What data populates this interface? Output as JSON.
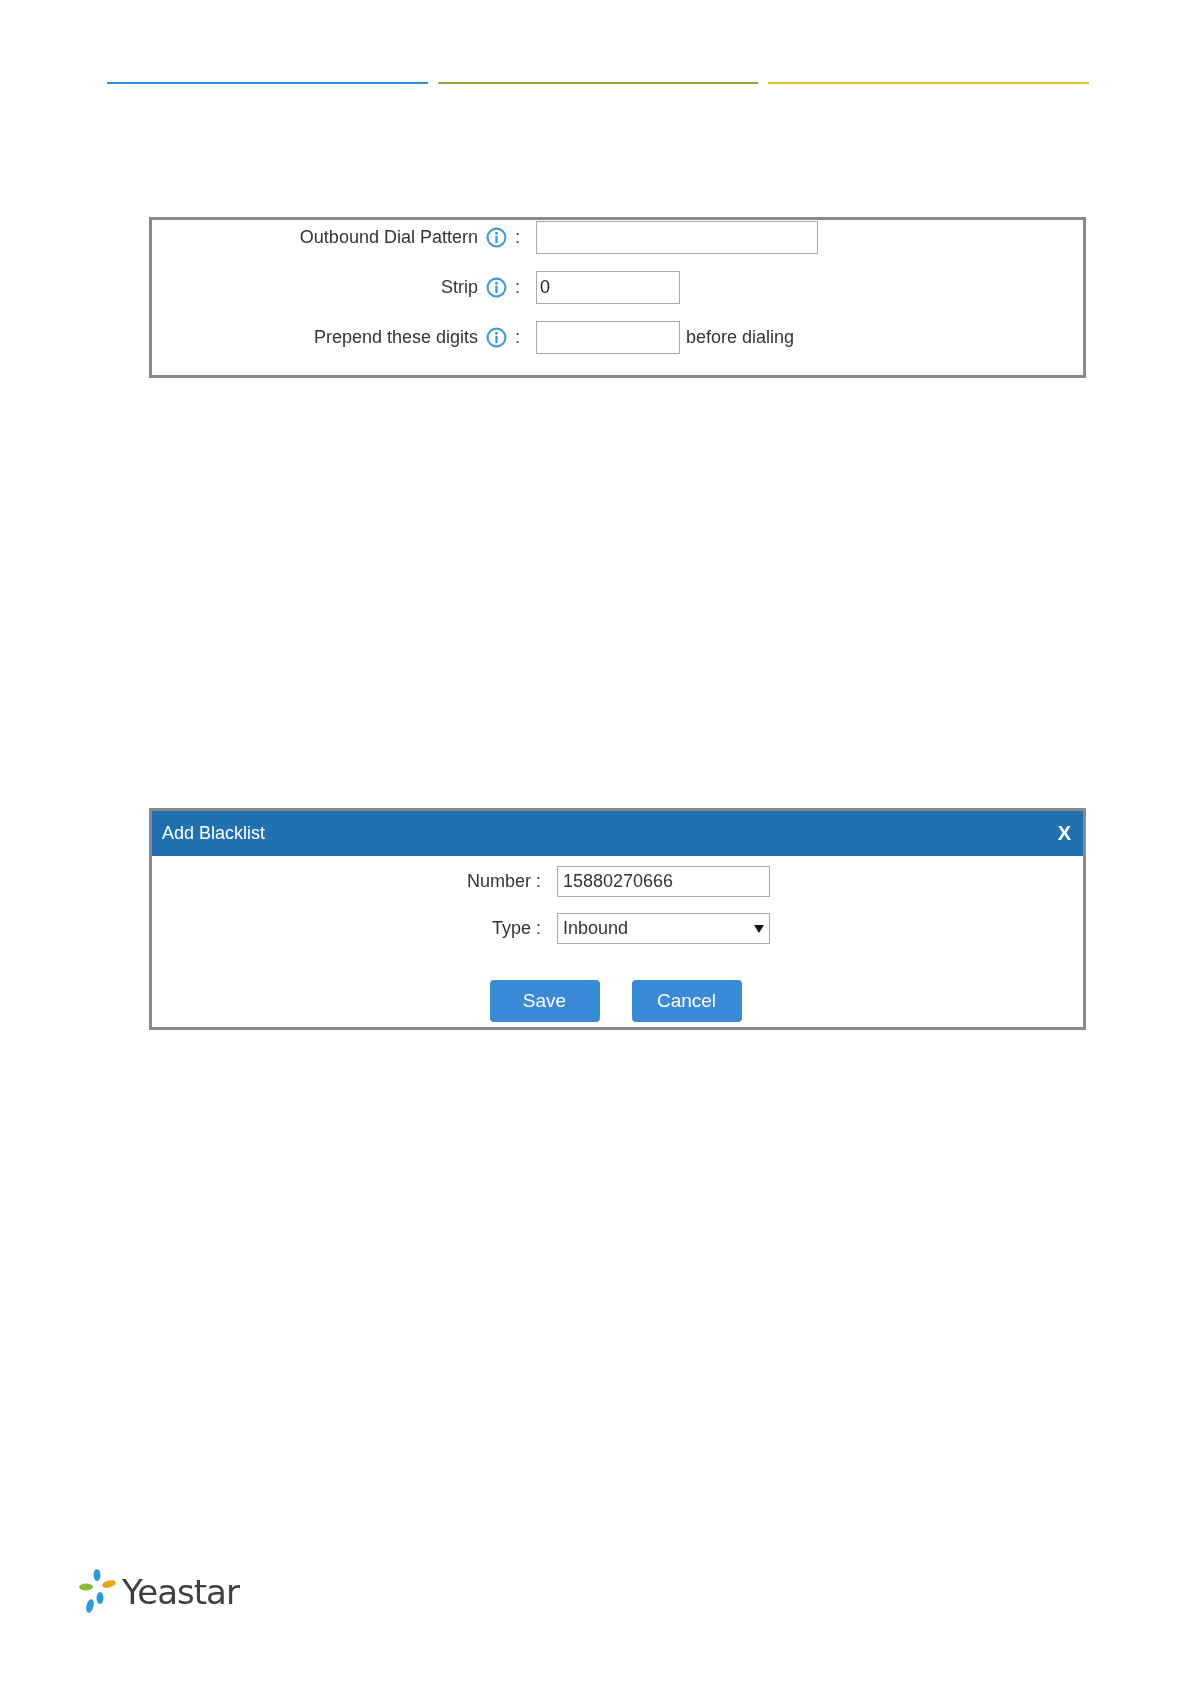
{
  "dial_settings": {
    "rows": [
      {
        "label": "Outbound Dial Pattern",
        "colon": ":",
        "value": ""
      },
      {
        "label": "Strip",
        "colon": ":",
        "value": "0"
      },
      {
        "label": "Prepend these digits",
        "colon": ":",
        "value": "",
        "suffix": "before dialing"
      }
    ]
  },
  "add_blacklist_dialog": {
    "title": "Add Blacklist",
    "close": "X",
    "fields": [
      {
        "kind": "input",
        "label": "Number :",
        "value": "15880270666"
      },
      {
        "kind": "select",
        "label": "Type :",
        "value": "Inbound"
      }
    ],
    "buttons": [
      "Save",
      "Cancel"
    ]
  },
  "footer": {
    "logo": "Yeastar"
  }
}
